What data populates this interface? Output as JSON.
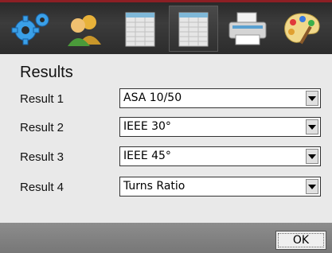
{
  "toolbar": {
    "tabs": [
      {
        "icon": "gear-icon"
      },
      {
        "icon": "users-icon"
      },
      {
        "icon": "table-icon"
      },
      {
        "icon": "table-icon",
        "selected": true
      },
      {
        "icon": "printer-icon"
      },
      {
        "icon": "palette-icon"
      }
    ]
  },
  "section": {
    "title": "Results"
  },
  "results": [
    {
      "label": "Result 1",
      "value": "ASA 10/50"
    },
    {
      "label": "Result 2",
      "value": "IEEE 30°"
    },
    {
      "label": "Result 3",
      "value": "IEEE 45°"
    },
    {
      "label": "Result 4",
      "value": "Turns Ratio"
    }
  ],
  "footer": {
    "ok_label": "OK"
  },
  "colors": {
    "accent": "#8c1f24",
    "topbar": "#333333",
    "panel": "#e9e9e9",
    "footer": "#808080"
  }
}
